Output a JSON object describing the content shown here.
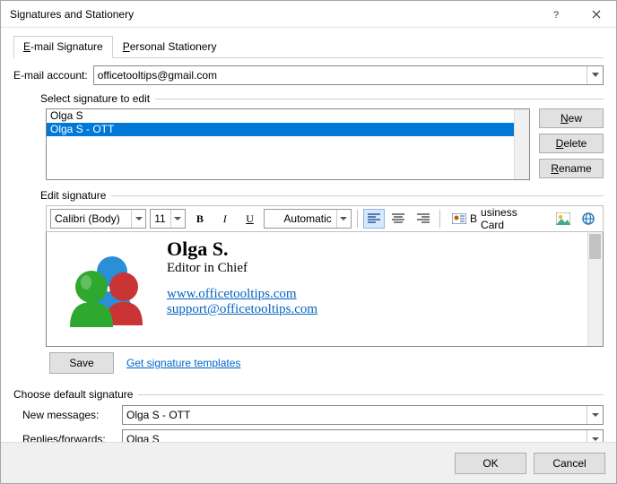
{
  "window": {
    "title": "Signatures and Stationery"
  },
  "tabs": {
    "email": "E-mail Signature",
    "personal": "Personal Stationery"
  },
  "email_account": {
    "label": "E-mail account:",
    "value": "officetooltips@gmail.com"
  },
  "select_sig_label": "Select signature to edit",
  "signatures": {
    "items": [
      "Olga S",
      "Olga S - OTT"
    ],
    "selected_index": 1
  },
  "buttons": {
    "new": "New",
    "delete": "Delete",
    "rename": "Rename",
    "save": "Save",
    "ok": "OK",
    "cancel": "Cancel"
  },
  "edit_label": "Edit signature",
  "toolbar": {
    "font": "Calibri (Body)",
    "size": "11",
    "color": "Automatic",
    "businesscard": "Business Card"
  },
  "signature_preview": {
    "name": "Olga S.",
    "role": "Editor in Chief",
    "website": "www.officetooltips.com",
    "email": "support@officetooltips.com"
  },
  "templates_link": "Get signature templates",
  "defaults": {
    "heading": "Choose default signature",
    "new_label": "New messages:",
    "new_value": "Olga S - OTT",
    "reply_label": "Replies/forwards:",
    "reply_value": "Olga S"
  }
}
